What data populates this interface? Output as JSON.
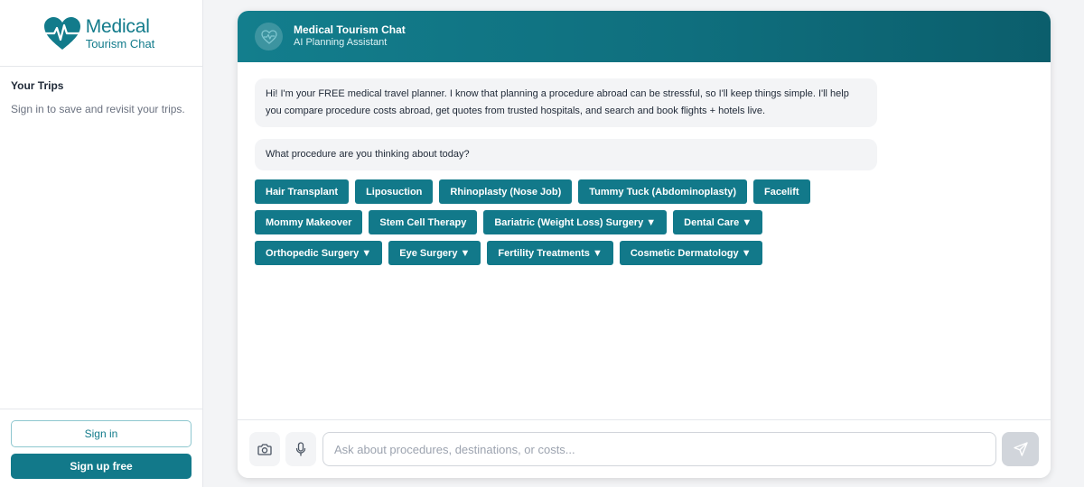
{
  "brand": {
    "name": "Medical",
    "tagline": "Tourism Chat",
    "color": "#127b8b"
  },
  "sidebar": {
    "trips_title": "Your Trips",
    "trips_subtitle": "Sign in to save and revisit your trips.",
    "signin_label": "Sign in",
    "signup_label": "Sign up free"
  },
  "chat": {
    "title": "Medical Tourism Chat",
    "subtitle": "AI Planning Assistant",
    "avatar_icon": "heart-pulse-icon",
    "messages": [
      {
        "role": "assistant",
        "text": "Hi! I'm your FREE medical travel planner. I know that planning a procedure abroad can be stressful, so I'll keep things simple. I'll help you compare procedure costs abroad, get quotes from trusted hospitals, and search and book flights + hotels live."
      },
      {
        "role": "assistant",
        "text": "What procedure are you thinking about today?"
      }
    ],
    "chips": [
      "Hair Transplant",
      "Liposuction",
      "Rhinoplasty (Nose Job)",
      "Tummy Tuck (Abdominoplasty)",
      "Facelift",
      "Mommy Makeover",
      "Stem Cell Therapy",
      "Bariatric (Weight Loss) Surgery ▼",
      "Dental Care ▼",
      "Orthopedic Surgery ▼",
      "Eye Surgery ▼",
      "Fertility Treatments ▼",
      "Cosmetic Dermatology ▼"
    ],
    "input": {
      "placeholder": "Ask about procedures, destinations, or costs...",
      "value": "",
      "camera_icon": "camera-icon",
      "mic_icon": "microphone-icon",
      "send_icon": "send-icon"
    }
  },
  "colors": {
    "accent": "#12798a",
    "header_start": "#137e8d",
    "header_end": "#0b5e6c",
    "bubble_bg": "#f3f4f6",
    "send_disabled": "#d1d5db"
  }
}
